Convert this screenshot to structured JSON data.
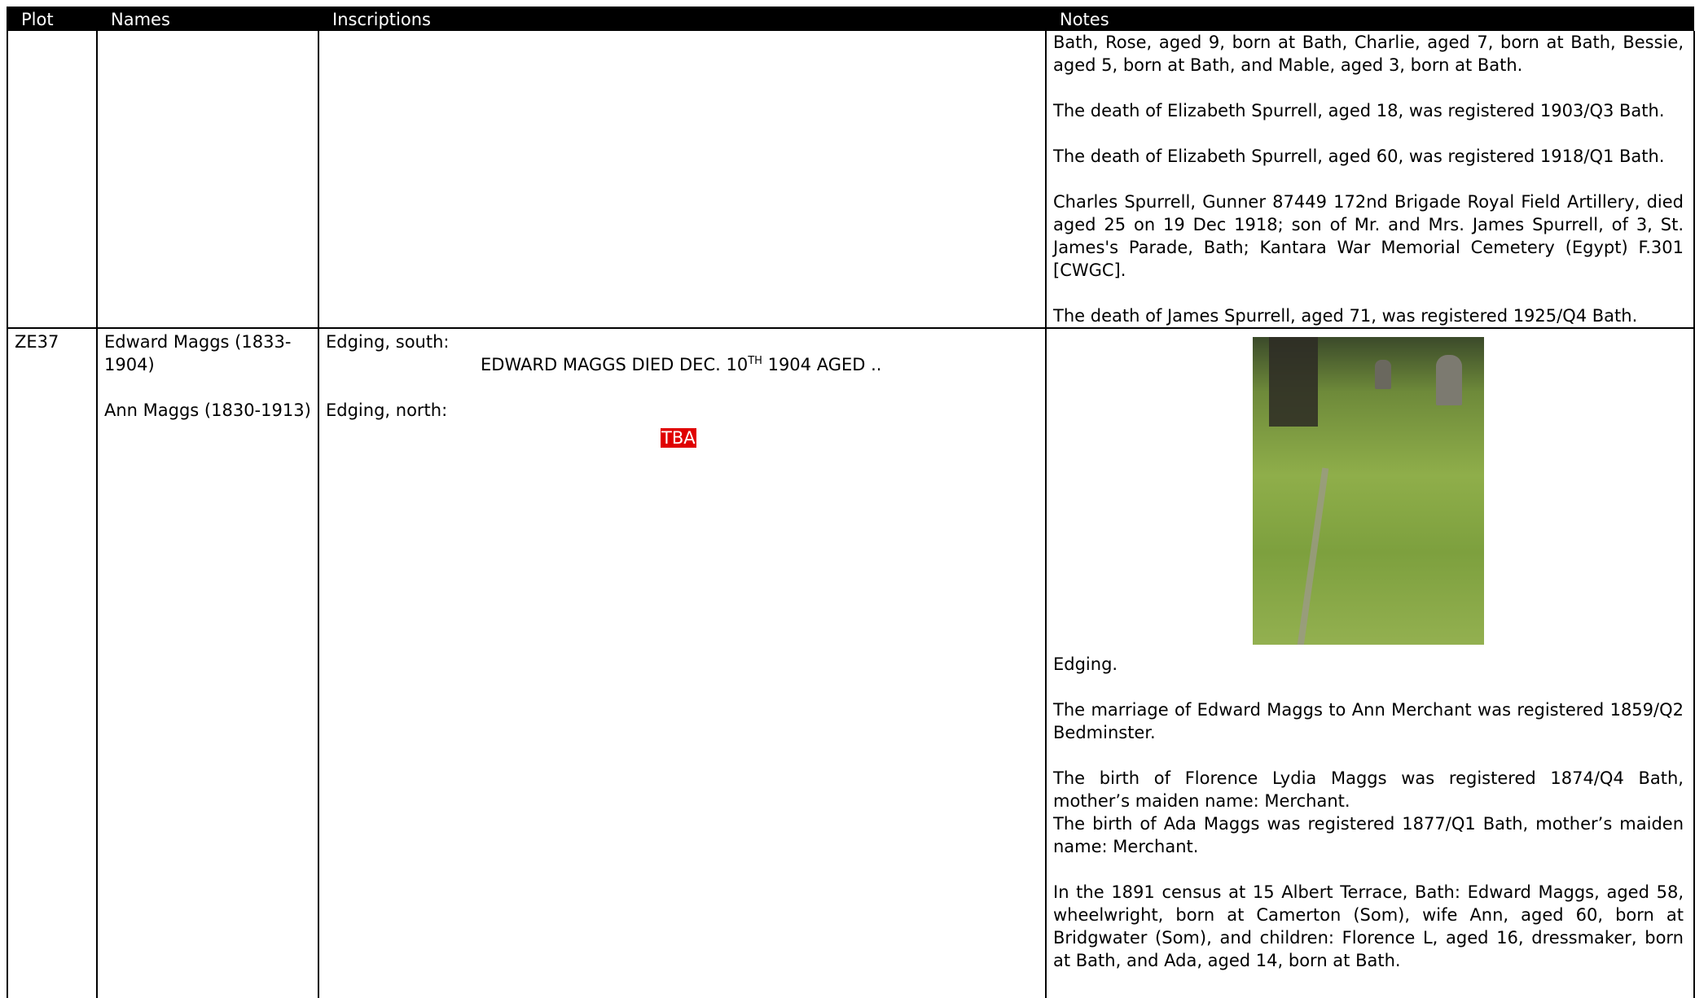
{
  "headers": {
    "plot": "Plot",
    "names": "Names",
    "inscriptions": "Inscriptions",
    "notes": "Notes"
  },
  "row1": {
    "notes": [
      "Bath, Rose, aged 9, born at Bath, Charlie, aged 7, born at Bath, Bessie, aged 5, born at Bath, and Mable, aged 3, born at Bath.",
      "The death of Elizabeth Spurrell, aged 18, was registered 1903/Q3 Bath.",
      "The death of Elizabeth Spurrell, aged 60, was registered 1918/Q1 Bath.",
      "Charles Spurrell, Gunner 87449 172nd Brigade Royal Field Artillery, died aged 25 on 19 Dec 1918; son of Mr. and Mrs. James Spurrell, of 3, St. James's Parade, Bath; Kantara War Memorial Cemetery (Egypt) F.301 [CWGC].",
      "The death of James Spurrell, aged 71, was registered 1925/Q4 Bath."
    ]
  },
  "row2": {
    "plot": "ZE37",
    "names": [
      "Edward Maggs (1833-1904)",
      "Ann Maggs (1830-1913)"
    ],
    "inscriptions": {
      "south_label": "Edging, south:",
      "south_text_a": "EDWARD MAGGS DIED DEC. 10",
      "south_text_sup": "TH",
      "south_text_b": " 1904 AGED ..",
      "north_label": "Edging, north:",
      "north_text": "TBA"
    },
    "photo_name": "grave-edging-photo",
    "notes": [
      "Edging.",
      "The marriage of Edward Maggs to Ann Merchant was registered 1859/Q2 Bedminster.",
      "The birth of Florence Lydia Maggs was registered 1874/Q4 Bath, mother’s maiden name: Merchant.",
      "The birth of Ada Maggs was registered 1877/Q1 Bath, mother’s maiden name: Merchant.",
      "In the 1891 census at 15 Albert Terrace, Bath: Edward Maggs, aged 58, wheelwright, born at Camerton (Som), wife Ann, aged 60, born at Bridgwater (Som), and children: Florence L, aged 16, dressmaker, born at Bath, and Ada, aged 14, born at Bath."
    ]
  },
  "colors": {
    "header_bg": "#000000",
    "tba_bg": "#e00000"
  }
}
